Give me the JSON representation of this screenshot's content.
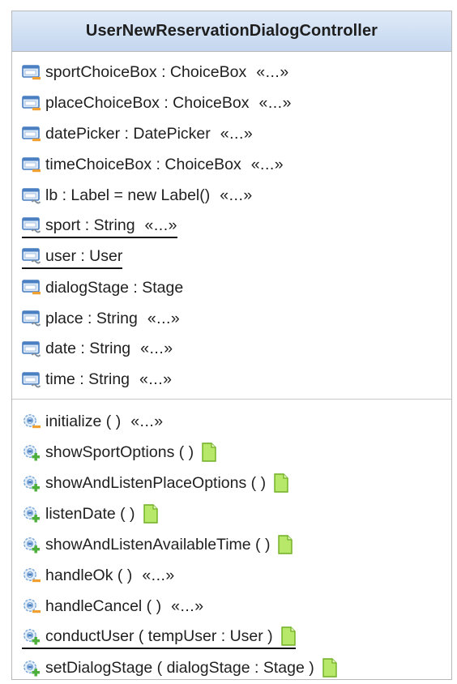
{
  "class_name": "UserNewReservationDialogController",
  "more_marker": "«...»",
  "attributes": [
    {
      "text": "sportChoiceBox : ChoiceBox",
      "visibility": "private",
      "static": false,
      "more": true
    },
    {
      "text": "placeChoiceBox : ChoiceBox",
      "visibility": "private",
      "static": false,
      "more": true
    },
    {
      "text": "datePicker : DatePicker",
      "visibility": "private",
      "static": false,
      "more": true
    },
    {
      "text": "timeChoiceBox : ChoiceBox",
      "visibility": "private",
      "static": false,
      "more": true
    },
    {
      "text": "lb : Label = new Label()",
      "visibility": "package",
      "static": false,
      "more": true
    },
    {
      "text": "sport : String",
      "visibility": "package",
      "static": true,
      "more": true
    },
    {
      "text": "user : User",
      "visibility": "package",
      "static": true,
      "more": false
    },
    {
      "text": "dialogStage : Stage",
      "visibility": "private",
      "static": false,
      "more": false
    },
    {
      "text": "place : String",
      "visibility": "package",
      "static": false,
      "more": true
    },
    {
      "text": "date : String",
      "visibility": "package",
      "static": false,
      "more": true
    },
    {
      "text": "time : String",
      "visibility": "package",
      "static": false,
      "more": true
    }
  ],
  "operations": [
    {
      "text": "initialize ( )",
      "visibility": "private",
      "static": false,
      "more": true,
      "note": false
    },
    {
      "text": "showSportOptions ( )",
      "visibility": "public",
      "static": false,
      "more": false,
      "note": true
    },
    {
      "text": "showAndListenPlaceOptions ( )",
      "visibility": "public",
      "static": false,
      "more": false,
      "note": true
    },
    {
      "text": "listenDate ( )",
      "visibility": "public",
      "static": false,
      "more": false,
      "note": true
    },
    {
      "text": "showAndListenAvailableTime ( )",
      "visibility": "public",
      "static": false,
      "more": false,
      "note": true
    },
    {
      "text": "handleOk ( )",
      "visibility": "private",
      "static": false,
      "more": true,
      "note": false
    },
    {
      "text": "handleCancel ( )",
      "visibility": "private",
      "static": false,
      "more": true,
      "note": false
    },
    {
      "text": "conductUser ( tempUser : User )",
      "visibility": "public",
      "static": true,
      "more": false,
      "note": true
    },
    {
      "text": "setDialogStage ( dialogStage : Stage )",
      "visibility": "public",
      "static": false,
      "more": false,
      "note": true
    }
  ],
  "colors": {
    "header_top": "#dfeaf8",
    "header_bottom": "#c4d7ef",
    "private_marker": "#f0a030",
    "public_marker": "#4caf3a",
    "package_marker": "#7f8c99",
    "note_fill": "#b7e86a",
    "note_stroke": "#6fae22",
    "field_icon": "#4a7fc1"
  }
}
